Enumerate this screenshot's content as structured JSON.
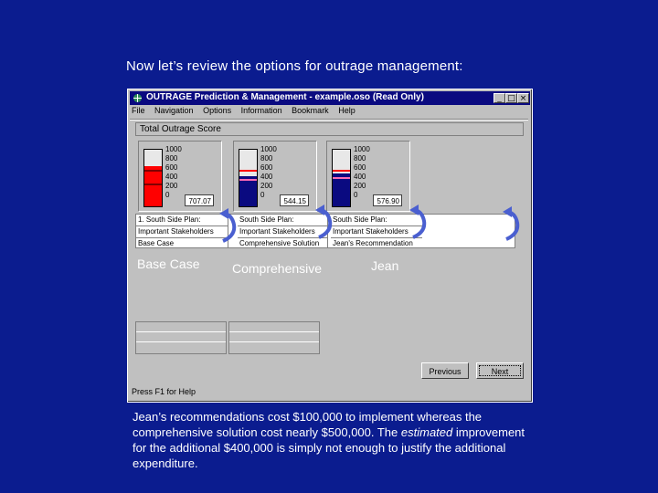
{
  "heading": "Now let’s review the options for outrage management:",
  "window": {
    "title": "OUTRAGE Prediction & Management - example.oso (Read Only)",
    "min_btn": "_",
    "max_btn": "□",
    "close_btn": "×"
  },
  "menu": [
    "File",
    "Navigation",
    "Options",
    "Information",
    "Bookmark",
    "Help"
  ],
  "score_box_label": "Total Outrage Score",
  "gauges": [
    {
      "ticks": [
        "1000",
        "800",
        "600",
        "400",
        "200",
        "0"
      ],
      "value": "707.07",
      "fill_fraction": 0.71,
      "fill_color": "#ff0000"
    },
    {
      "ticks": [
        "1000",
        "800",
        "600",
        "400",
        "200",
        "0"
      ],
      "value": "544.15",
      "fill_fraction": 0.54,
      "fill_color": "#0a0a80"
    },
    {
      "ticks": [
        "1000",
        "800",
        "600",
        "400",
        "200",
        "0"
      ],
      "value": "576.90",
      "fill_fraction": 0.58,
      "fill_color": "#0a0a80"
    }
  ],
  "label_rows": [
    [
      "1. South Side Plan:",
      "Important Stakeholders",
      "Base Case"
    ],
    [
      "South Side Plan:",
      "Important Stakeholders",
      "Comprehensive Solution"
    ],
    [
      "South Side Plan:",
      "Important Stakeholders",
      "Jean's Recommendation"
    ]
  ],
  "captions": [
    "Base Case",
    "Comprehensive",
    "Jean"
  ],
  "buttons": {
    "previous": "Previous",
    "next": "Next"
  },
  "status": "Press F1 for Help",
  "body_text": {
    "part1": "Jean’s recommendations cost $100,000 to implement whereas the comprehensive solution cost nearly $500,000.  The ",
    "emph": "estimated",
    "part2": " improvement for the additional $400,000 is simply not enough to justify the additional expenditure."
  }
}
